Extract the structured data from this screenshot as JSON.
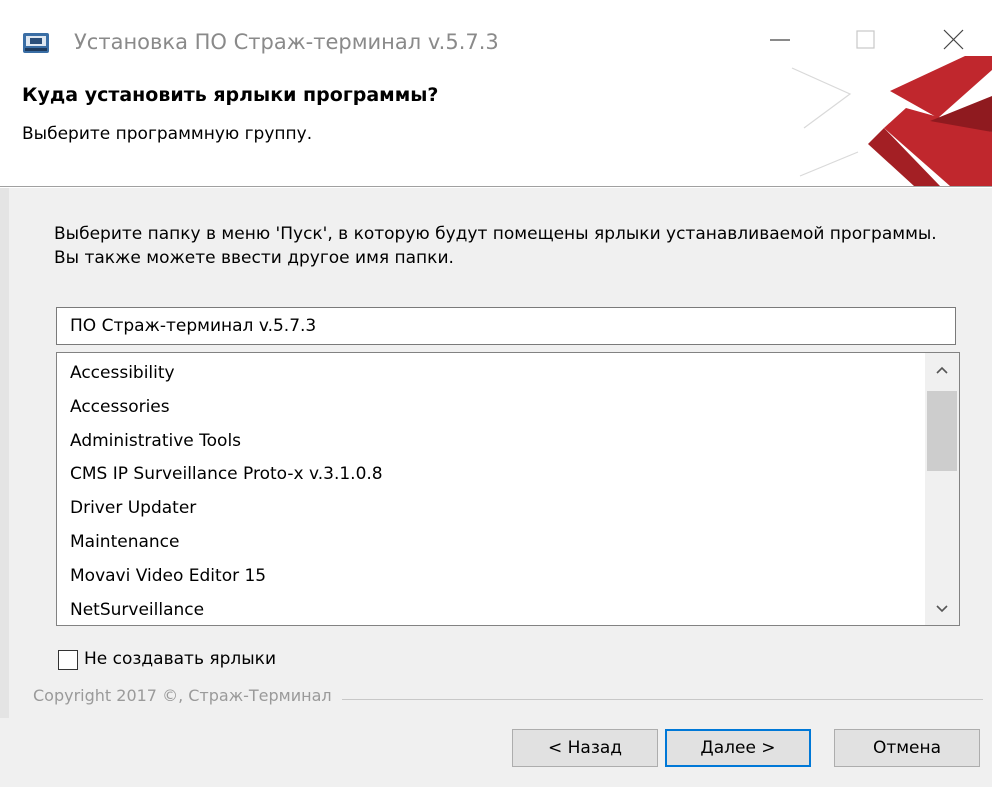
{
  "window": {
    "title": "Установка ПО Страж-терминал v.5.7.3",
    "controls": {
      "minimize": "minimize-icon",
      "maximize": "maximize-icon",
      "close": "close-icon"
    }
  },
  "header": {
    "title": "Куда установить ярлыки программы?",
    "subtitle": "Выберите программную группу."
  },
  "body": {
    "description": "Выберите папку в меню 'Пуск', в которую будут помещены ярлыки устанавливаемой программы. Вы также можете ввести другое имя папки.",
    "folder_input_value": "ПО Страж-терминал v.5.7.3",
    "folder_list": [
      "Accessibility",
      "Accessories",
      "Administrative Tools",
      "CMS IP Surveillance Proto-x v.3.1.0.8",
      "Driver Updater",
      "Maintenance",
      "Movavi Video Editor 15",
      "NetSurveillance"
    ],
    "checkbox_label": "Не создавать ярлыки",
    "checkbox_checked": false
  },
  "footer": {
    "copyright": "Copyright 2017 ©, Страж-Терминал",
    "back_label": "< Назад",
    "next_label": "Далее >",
    "cancel_label": "Отмена"
  },
  "colors": {
    "accent": "#0078d7",
    "logo_red": "#c0272d",
    "background": "#f0f0f0"
  }
}
